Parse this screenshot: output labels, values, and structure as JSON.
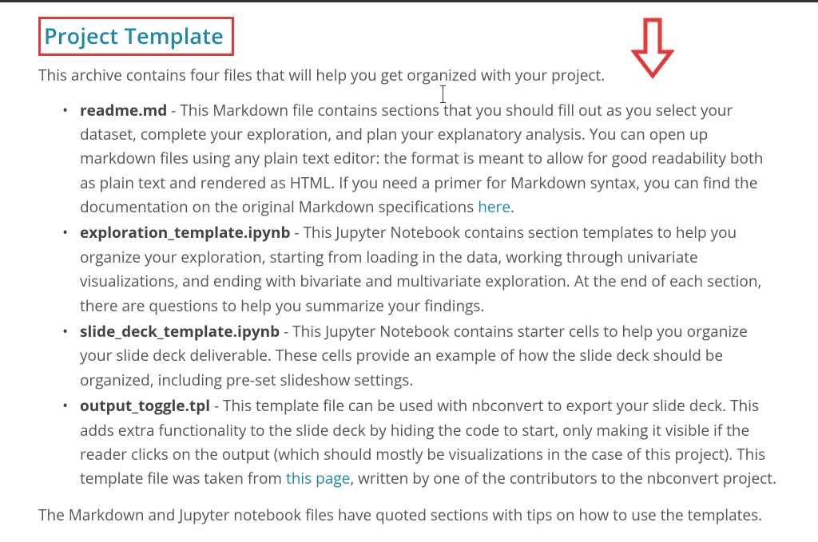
{
  "heading": "Project Template",
  "intro": "This archive contains four files that will help you get organized with your project.",
  "items": [
    {
      "name": "readme.md",
      "desc_before": " - This Markdown file contains sections that you should fill out as you select your dataset, complete your exploration, and plan your explanatory analysis. You can open up markdown files using any plain text editor: the format is meant to allow for good readability both as plain text and rendered as HTML. If you need a primer for Markdown syntax, you can find the documentation on the original Markdown specifications ",
      "link": "here",
      "desc_after": "."
    },
    {
      "name": "exploration_template.ipynb",
      "desc_before": " - This Jupyter Notebook contains section templates to help you organize your exploration, starting from loading in the data, working through univariate visualizations, and ending with bivariate and multivariate exploration. At the end of each section, there are questions to help you summarize your findings.",
      "link": "",
      "desc_after": ""
    },
    {
      "name": "slide_deck_template.ipynb",
      "desc_before": " - This Jupyter Notebook contains starter cells to help you organize your slide deck deliverable. These cells provide an example of how the slide deck should be organized, including pre-set slideshow settings.",
      "link": "",
      "desc_after": ""
    },
    {
      "name": "output_toggle.tpl",
      "desc_before": " - This template file can be used with nbconvert to export your slide deck. This adds extra functionality to the slide deck by hiding the code to start, only making it visible if the reader clicks on the output (which should mostly be visualizations in the case of this project). This template file was taken from ",
      "link": "this page",
      "desc_after": ", written by one of the contributors to the nbconvert project."
    }
  ],
  "footer": "The Markdown and Jupyter notebook files have quoted sections with tips on how to use the templates."
}
